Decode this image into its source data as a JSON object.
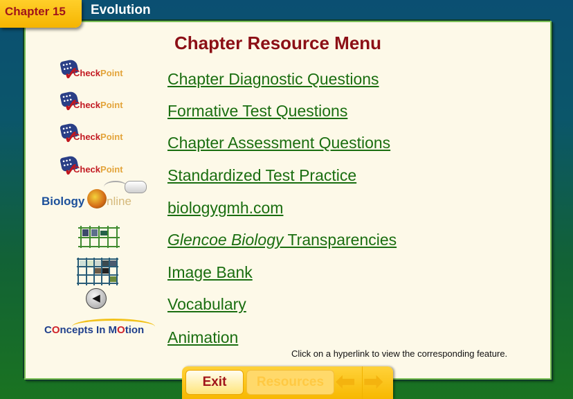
{
  "header": {
    "chapter_label": "Chapter 15",
    "topic": "Evolution"
  },
  "menu": {
    "title": "Chapter Resource Menu",
    "items": [
      {
        "icon": "checkpoint-logo",
        "icon_text_a": "Check",
        "icon_text_b": "Point",
        "label": "Chapter Diagnostic Questions"
      },
      {
        "icon": "checkpoint-logo",
        "icon_text_a": "Check",
        "icon_text_b": "Point",
        "label": "Formative Test Questions"
      },
      {
        "icon": "checkpoint-logo",
        "icon_text_a": "Check",
        "icon_text_b": "Point",
        "label": "Chapter Assessment Questions"
      },
      {
        "icon": "checkpoint-logo",
        "icon_text_a": "Check",
        "icon_text_b": "Point",
        "label": "Standardized Test Practice"
      },
      {
        "icon": "biology-online-logo",
        "icon_text_a": "Biology",
        "icon_text_b": "nline",
        "label": "biologygmh.com"
      },
      {
        "icon": "transparencies-grid-icon",
        "label_italic": "Glencoe Biology",
        "label": " Transparencies"
      },
      {
        "icon": "image-bank-grid-icon",
        "label": "Image Bank"
      },
      {
        "icon": "speaker-icon",
        "label": "Vocabulary"
      },
      {
        "icon": "concepts-in-motion-logo",
        "icon_text": "Concepts In Motion",
        "label": "Animation"
      }
    ],
    "hint": "Click on a hyperlink to view the corresponding feature."
  },
  "navbar": {
    "exit_label": "Exit",
    "resources_label": "Resources",
    "prev_icon": "arrow-left-icon",
    "next_icon": "arrow-right-icon"
  },
  "colors": {
    "link": "#1a6e10",
    "title": "#8c0f16",
    "tab": "#f5b400"
  }
}
